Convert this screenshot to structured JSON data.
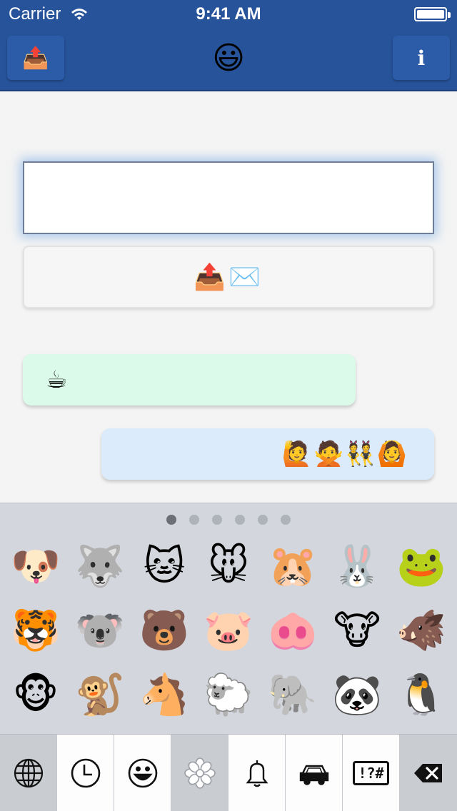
{
  "status_bar": {
    "carrier": "Carrier",
    "time": "9:41 AM",
    "battery_level": 1.0
  },
  "nav_bar": {
    "left_icon": "outbox-tray-icon",
    "left_glyph": "📤",
    "title": "😃",
    "right_label": "i"
  },
  "compose": {
    "text_value": "",
    "send_label": "📤✉️"
  },
  "messages": [
    {
      "direction": "incoming",
      "text": "☕",
      "color": "#dcfaea"
    },
    {
      "direction": "outgoing",
      "text": "🙋🙅👯🙆",
      "color": "#dcebfc"
    }
  ],
  "keyboard": {
    "page_count": 6,
    "current_page": 0,
    "emojis": [
      "🐶",
      "🐺",
      "🐱",
      "🐭",
      "🐹",
      "🐰",
      "🐸",
      "🐯",
      "🐨",
      "🐻",
      "🐷",
      "🐽",
      "🐮",
      "🐗",
      "🐵",
      "🐒",
      "🐴",
      "🐑",
      "🐘",
      "🐼",
      "🐧"
    ],
    "categories": [
      {
        "name": "globe-icon",
        "selected": false
      },
      {
        "name": "clock-icon",
        "selected": false
      },
      {
        "name": "smiley-icon",
        "selected": false
      },
      {
        "name": "flower-icon",
        "selected": true
      },
      {
        "name": "bell-icon",
        "selected": false
      },
      {
        "name": "car-icon",
        "selected": false
      },
      {
        "name": "symbols-icon",
        "selected": false,
        "label": "!?#"
      },
      {
        "name": "delete-icon",
        "selected": false
      }
    ]
  },
  "colors": {
    "nav_bar": "#27539a",
    "keyboard": "#d3d6dc"
  }
}
